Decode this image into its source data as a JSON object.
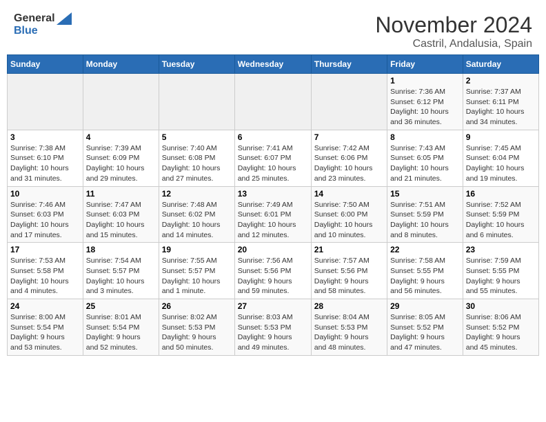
{
  "header": {
    "logo_general": "General",
    "logo_blue": "Blue",
    "month": "November 2024",
    "location": "Castril, Andalusia, Spain"
  },
  "weekdays": [
    "Sunday",
    "Monday",
    "Tuesday",
    "Wednesday",
    "Thursday",
    "Friday",
    "Saturday"
  ],
  "weeks": [
    [
      {
        "day": "",
        "info": ""
      },
      {
        "day": "",
        "info": ""
      },
      {
        "day": "",
        "info": ""
      },
      {
        "day": "",
        "info": ""
      },
      {
        "day": "",
        "info": ""
      },
      {
        "day": "1",
        "info": "Sunrise: 7:36 AM\nSunset: 6:12 PM\nDaylight: 10 hours\nand 36 minutes."
      },
      {
        "day": "2",
        "info": "Sunrise: 7:37 AM\nSunset: 6:11 PM\nDaylight: 10 hours\nand 34 minutes."
      }
    ],
    [
      {
        "day": "3",
        "info": "Sunrise: 7:38 AM\nSunset: 6:10 PM\nDaylight: 10 hours\nand 31 minutes."
      },
      {
        "day": "4",
        "info": "Sunrise: 7:39 AM\nSunset: 6:09 PM\nDaylight: 10 hours\nand 29 minutes."
      },
      {
        "day": "5",
        "info": "Sunrise: 7:40 AM\nSunset: 6:08 PM\nDaylight: 10 hours\nand 27 minutes."
      },
      {
        "day": "6",
        "info": "Sunrise: 7:41 AM\nSunset: 6:07 PM\nDaylight: 10 hours\nand 25 minutes."
      },
      {
        "day": "7",
        "info": "Sunrise: 7:42 AM\nSunset: 6:06 PM\nDaylight: 10 hours\nand 23 minutes."
      },
      {
        "day": "8",
        "info": "Sunrise: 7:43 AM\nSunset: 6:05 PM\nDaylight: 10 hours\nand 21 minutes."
      },
      {
        "day": "9",
        "info": "Sunrise: 7:45 AM\nSunset: 6:04 PM\nDaylight: 10 hours\nand 19 minutes."
      }
    ],
    [
      {
        "day": "10",
        "info": "Sunrise: 7:46 AM\nSunset: 6:03 PM\nDaylight: 10 hours\nand 17 minutes."
      },
      {
        "day": "11",
        "info": "Sunrise: 7:47 AM\nSunset: 6:03 PM\nDaylight: 10 hours\nand 15 minutes."
      },
      {
        "day": "12",
        "info": "Sunrise: 7:48 AM\nSunset: 6:02 PM\nDaylight: 10 hours\nand 14 minutes."
      },
      {
        "day": "13",
        "info": "Sunrise: 7:49 AM\nSunset: 6:01 PM\nDaylight: 10 hours\nand 12 minutes."
      },
      {
        "day": "14",
        "info": "Sunrise: 7:50 AM\nSunset: 6:00 PM\nDaylight: 10 hours\nand 10 minutes."
      },
      {
        "day": "15",
        "info": "Sunrise: 7:51 AM\nSunset: 5:59 PM\nDaylight: 10 hours\nand 8 minutes."
      },
      {
        "day": "16",
        "info": "Sunrise: 7:52 AM\nSunset: 5:59 PM\nDaylight: 10 hours\nand 6 minutes."
      }
    ],
    [
      {
        "day": "17",
        "info": "Sunrise: 7:53 AM\nSunset: 5:58 PM\nDaylight: 10 hours\nand 4 minutes."
      },
      {
        "day": "18",
        "info": "Sunrise: 7:54 AM\nSunset: 5:57 PM\nDaylight: 10 hours\nand 3 minutes."
      },
      {
        "day": "19",
        "info": "Sunrise: 7:55 AM\nSunset: 5:57 PM\nDaylight: 10 hours\nand 1 minute."
      },
      {
        "day": "20",
        "info": "Sunrise: 7:56 AM\nSunset: 5:56 PM\nDaylight: 9 hours\nand 59 minutes."
      },
      {
        "day": "21",
        "info": "Sunrise: 7:57 AM\nSunset: 5:56 PM\nDaylight: 9 hours\nand 58 minutes."
      },
      {
        "day": "22",
        "info": "Sunrise: 7:58 AM\nSunset: 5:55 PM\nDaylight: 9 hours\nand 56 minutes."
      },
      {
        "day": "23",
        "info": "Sunrise: 7:59 AM\nSunset: 5:55 PM\nDaylight: 9 hours\nand 55 minutes."
      }
    ],
    [
      {
        "day": "24",
        "info": "Sunrise: 8:00 AM\nSunset: 5:54 PM\nDaylight: 9 hours\nand 53 minutes."
      },
      {
        "day": "25",
        "info": "Sunrise: 8:01 AM\nSunset: 5:54 PM\nDaylight: 9 hours\nand 52 minutes."
      },
      {
        "day": "26",
        "info": "Sunrise: 8:02 AM\nSunset: 5:53 PM\nDaylight: 9 hours\nand 50 minutes."
      },
      {
        "day": "27",
        "info": "Sunrise: 8:03 AM\nSunset: 5:53 PM\nDaylight: 9 hours\nand 49 minutes."
      },
      {
        "day": "28",
        "info": "Sunrise: 8:04 AM\nSunset: 5:53 PM\nDaylight: 9 hours\nand 48 minutes."
      },
      {
        "day": "29",
        "info": "Sunrise: 8:05 AM\nSunset: 5:52 PM\nDaylight: 9 hours\nand 47 minutes."
      },
      {
        "day": "30",
        "info": "Sunrise: 8:06 AM\nSunset: 5:52 PM\nDaylight: 9 hours\nand 45 minutes."
      }
    ]
  ]
}
